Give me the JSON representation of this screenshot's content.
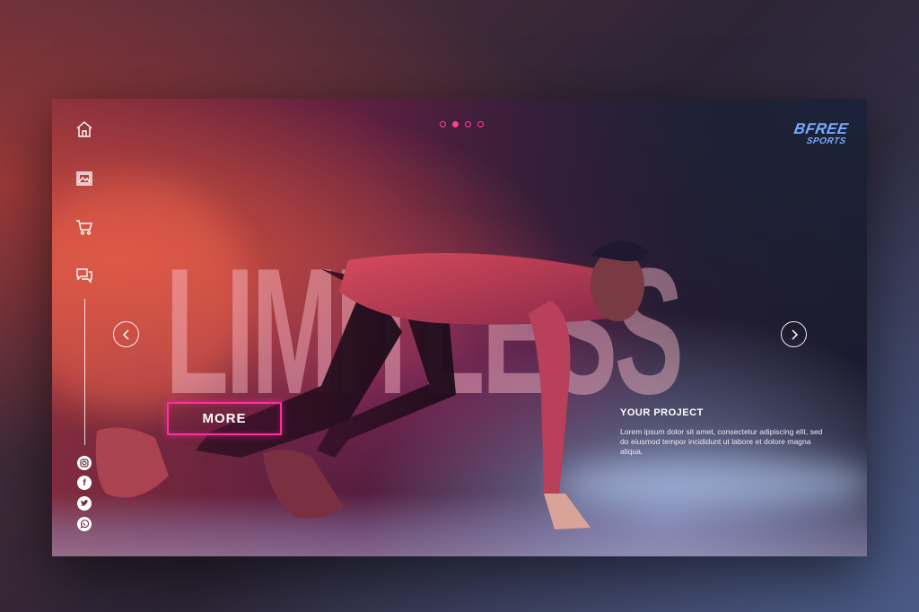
{
  "hero": {
    "headline": "LIMITLESS",
    "more_label": "MORE"
  },
  "pagination": {
    "count": 4,
    "active_index": 1
  },
  "logo": {
    "line1": "BFREE",
    "line2": "SPORTS"
  },
  "sidebar": {
    "icons": [
      "home-icon",
      "gallery-icon",
      "cart-icon",
      "chat-icon"
    ],
    "social": [
      "instagram-icon",
      "facebook-icon",
      "twitter-icon",
      "whatsapp-icon"
    ]
  },
  "project": {
    "title": "YOUR PROJECT",
    "body": "Lorem ipsum dolor sit amet, consectetur adipiscing elit, sed do eiusmod tempor incididunt ut labore et dolore magna aliqua."
  },
  "colors": {
    "accent": "#ff2f9e",
    "logo": "#7aa8ff"
  }
}
